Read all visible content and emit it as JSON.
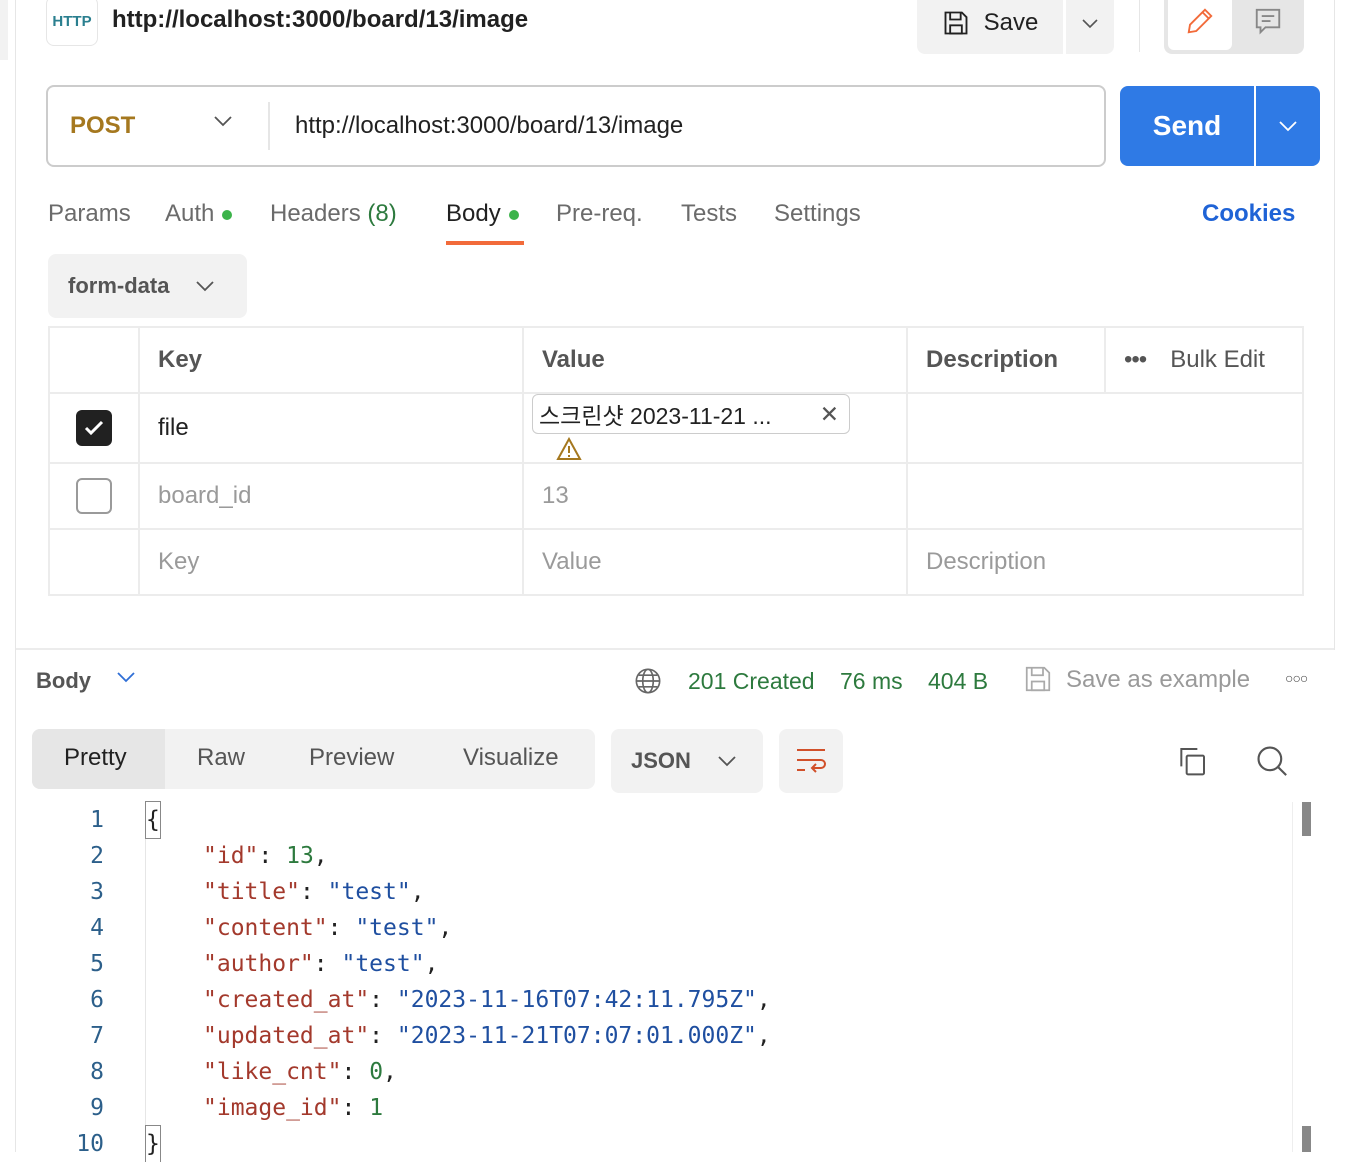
{
  "header": {
    "protocol_badge": "HTTP",
    "title": "http://localhost:3000/board/13/image",
    "save_label": "Save"
  },
  "request": {
    "method": "POST",
    "url": "http://localhost:3000/board/13/image",
    "send_label": "Send",
    "method_color": "#a5781f",
    "send_color": "#2f7ae5"
  },
  "tabs": [
    {
      "label": "Params"
    },
    {
      "label": "Auth",
      "dot": true
    },
    {
      "label": "Headers",
      "count": "(8)"
    },
    {
      "label": "Body",
      "dot": true,
      "active": true
    },
    {
      "label": "Pre-req."
    },
    {
      "label": "Tests"
    },
    {
      "label": "Settings"
    }
  ],
  "cookies_label": "Cookies",
  "body_type": "form-data",
  "table": {
    "headers": {
      "key": "Key",
      "value": "Value",
      "description": "Description",
      "bulk_edit": "Bulk Edit"
    },
    "rows": [
      {
        "checked": true,
        "key": "file",
        "value": "스크린샷 2023-11-21 ...",
        "value_type": "file",
        "warning": true
      },
      {
        "checked": false,
        "key": "board_id",
        "value": "13"
      }
    ],
    "placeholders": {
      "key": "Key",
      "value": "Value",
      "description": "Description"
    }
  },
  "response": {
    "section_label": "Body",
    "status": "201 Created",
    "time": "76 ms",
    "size": "404 B",
    "save_example_label": "Save as example",
    "views": [
      "Pretty",
      "Raw",
      "Preview",
      "Visualize"
    ],
    "active_view": "Pretty",
    "format": "JSON",
    "lines": [
      "1",
      "2",
      "3",
      "4",
      "5",
      "6",
      "7",
      "8",
      "9",
      "10"
    ],
    "json": {
      "id": "13",
      "title": "\"test\"",
      "content": "\"test\"",
      "author": "\"test\"",
      "created_at": "\"2023-11-16T07:42:11.795Z\"",
      "updated_at": "\"2023-11-21T07:07:01.000Z\"",
      "like_cnt": "0",
      "image_id": "1"
    }
  }
}
